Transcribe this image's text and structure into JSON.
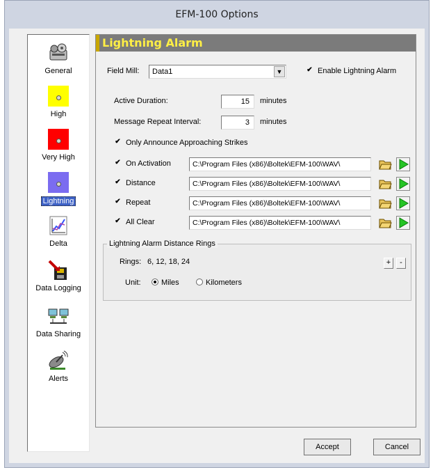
{
  "window": {
    "title": "EFM-100 Options"
  },
  "sidebar": {
    "items": [
      {
        "label": "General",
        "icon": "gear-icon"
      },
      {
        "label": "High",
        "icon": "yellow-swatch-icon",
        "color": "#ffff00"
      },
      {
        "label": "Very High",
        "icon": "red-swatch-icon",
        "color": "#ff0000"
      },
      {
        "label": "Lightning",
        "icon": "purple-swatch-icon",
        "color": "#7b6cf0",
        "selected": true
      },
      {
        "label": "Delta",
        "icon": "chart-icon"
      },
      {
        "label": "Data Logging",
        "icon": "save-disk-icon"
      },
      {
        "label": "Data Sharing",
        "icon": "network-icon"
      },
      {
        "label": "Alerts",
        "icon": "satellite-dish-icon"
      }
    ]
  },
  "panel": {
    "title": "Lightning Alarm",
    "field_mill_label": "Field Mill:",
    "field_mill_value": "Data1",
    "enable_label": "Enable Lightning Alarm",
    "enable_checked": true,
    "active_duration_label": "Active Duration:",
    "active_duration_value": "15",
    "active_duration_unit": "minutes",
    "repeat_interval_label": "Message Repeat Interval:",
    "repeat_interval_value": "3",
    "repeat_interval_unit": "minutes",
    "only_approaching_label": "Only Announce Approaching Strikes",
    "only_approaching_checked": true,
    "sounds": [
      {
        "label": "On Activation",
        "checked": true,
        "path": "C:\\Program Files (x86)\\Boltek\\EFM-100\\WAV\\"
      },
      {
        "label": "Distance",
        "checked": true,
        "path": "C:\\Program Files (x86)\\Boltek\\EFM-100\\WAV\\"
      },
      {
        "label": "Repeat",
        "checked": true,
        "path": "C:\\Program Files (x86)\\Boltek\\EFM-100\\WAV\\"
      },
      {
        "label": "All Clear",
        "checked": true,
        "path": "C:\\Program Files (x86)\\Boltek\\EFM-100\\WAV\\"
      }
    ],
    "rings_group_title": "Lightning Alarm Distance Rings",
    "rings_label": "Rings:",
    "rings_value": "6, 12, 18, 24",
    "add_label": "+",
    "remove_label": "-",
    "unit_label": "Unit:",
    "unit_options": [
      {
        "label": "Miles",
        "selected": true
      },
      {
        "label": "Kilometers",
        "selected": false
      }
    ]
  },
  "footer": {
    "accept_label": "Accept",
    "cancel_label": "Cancel"
  }
}
